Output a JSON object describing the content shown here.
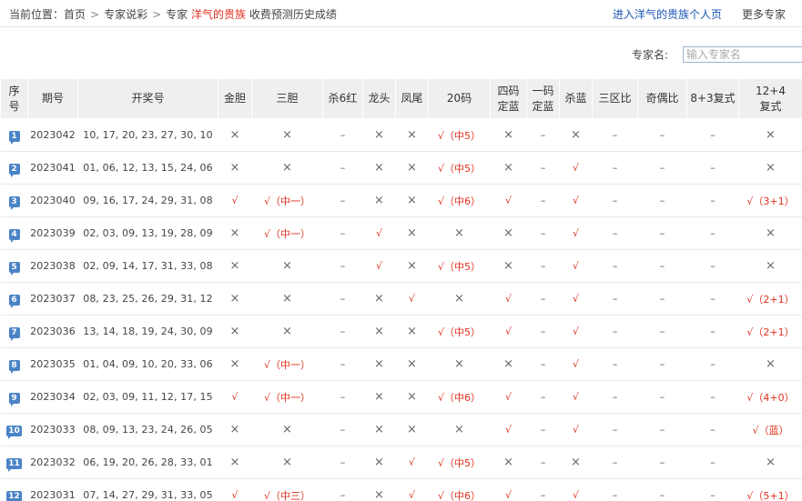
{
  "breadcrumb": {
    "prefix": "当前位置：",
    "home": "首页",
    "experts": "专家说彩",
    "expert": "专家",
    "name": "洋气的贵族",
    "suffix": "收费预测历史成绩",
    "sep": ">"
  },
  "links": {
    "personal_page": "进入洋气的贵族个人页",
    "more_experts": "更多专家"
  },
  "search": {
    "label": "专家名:",
    "placeholder": "输入专家名"
  },
  "table": {
    "headers": [
      "序号",
      "期号",
      "开奖号",
      "金胆",
      "三胆",
      "杀6红",
      "龙头",
      "凤尾",
      "20码",
      "四码定蓝",
      "一码定蓝",
      "杀蓝",
      "三区比",
      "奇偶比",
      "8+3复式",
      "12+4复式"
    ],
    "rows": [
      {
        "no": "1",
        "period": "2023042",
        "numbers": "10, 17, 20, 23, 27, 30, 10",
        "cells": [
          "×",
          "×",
          "–",
          "×",
          "×",
          "√（中5）",
          "×",
          "–",
          "×",
          "–",
          "–",
          "–",
          "×"
        ]
      },
      {
        "no": "2",
        "period": "2023041",
        "numbers": "01, 06, 12, 13, 15, 24, 06",
        "cells": [
          "×",
          "×",
          "–",
          "×",
          "×",
          "√（中5）",
          "×",
          "–",
          "√",
          "–",
          "–",
          "–",
          "×"
        ]
      },
      {
        "no": "3",
        "period": "2023040",
        "numbers": "09, 16, 17, 24, 29, 31, 08",
        "cells": [
          "√",
          "√（中一）",
          "–",
          "×",
          "×",
          "√（中6）",
          "√",
          "–",
          "√",
          "–",
          "–",
          "–",
          "√（3+1）"
        ]
      },
      {
        "no": "4",
        "period": "2023039",
        "numbers": "02, 03, 09, 13, 19, 28, 09",
        "cells": [
          "×",
          "√（中一）",
          "–",
          "√",
          "×",
          "×",
          "×",
          "–",
          "√",
          "–",
          "–",
          "–",
          "×"
        ]
      },
      {
        "no": "5",
        "period": "2023038",
        "numbers": "02, 09, 14, 17, 31, 33, 08",
        "cells": [
          "×",
          "×",
          "–",
          "√",
          "×",
          "√（中5）",
          "×",
          "–",
          "√",
          "–",
          "–",
          "–",
          "×"
        ]
      },
      {
        "no": "6",
        "period": "2023037",
        "numbers": "08, 23, 25, 26, 29, 31, 12",
        "cells": [
          "×",
          "×",
          "–",
          "×",
          "√",
          "×",
          "√",
          "–",
          "√",
          "–",
          "–",
          "–",
          "√（2+1）"
        ]
      },
      {
        "no": "7",
        "period": "2023036",
        "numbers": "13, 14, 18, 19, 24, 30, 09",
        "cells": [
          "×",
          "×",
          "–",
          "×",
          "×",
          "√（中5）",
          "√",
          "–",
          "√",
          "–",
          "–",
          "–",
          "√（2+1）"
        ]
      },
      {
        "no": "8",
        "period": "2023035",
        "numbers": "01, 04, 09, 10, 20, 33, 06",
        "cells": [
          "×",
          "√（中一）",
          "–",
          "×",
          "×",
          "×",
          "×",
          "–",
          "√",
          "–",
          "–",
          "–",
          "×"
        ]
      },
      {
        "no": "9",
        "period": "2023034",
        "numbers": "02, 03, 09, 11, 12, 17, 15",
        "cells": [
          "√",
          "√（中一）",
          "–",
          "×",
          "×",
          "√（中6）",
          "√",
          "–",
          "√",
          "–",
          "–",
          "–",
          "√（4+0）"
        ]
      },
      {
        "no": "10",
        "period": "2023033",
        "numbers": "08, 09, 13, 23, 24, 26, 05",
        "cells": [
          "×",
          "×",
          "–",
          "×",
          "×",
          "×",
          "√",
          "–",
          "√",
          "–",
          "–",
          "–",
          "√（蓝）"
        ]
      },
      {
        "no": "11",
        "period": "2023032",
        "numbers": "06, 19, 20, 26, 28, 33, 01",
        "cells": [
          "×",
          "×",
          "–",
          "×",
          "√",
          "√（中5）",
          "×",
          "–",
          "×",
          "–",
          "–",
          "–",
          "×"
        ]
      },
      {
        "no": "12",
        "period": "2023031",
        "numbers": "07, 14, 27, 29, 31, 33, 05",
        "cells": [
          "√",
          "√（中三）",
          "–",
          "×",
          "√",
          "√（中6）",
          "√",
          "–",
          "√",
          "–",
          "–",
          "–",
          "√（5+1）"
        ]
      }
    ]
  },
  "colors": {
    "hit": "#e0301e",
    "link": "#1a56b4",
    "badge": "#4a84c6",
    "header_bg": "#efefef"
  }
}
